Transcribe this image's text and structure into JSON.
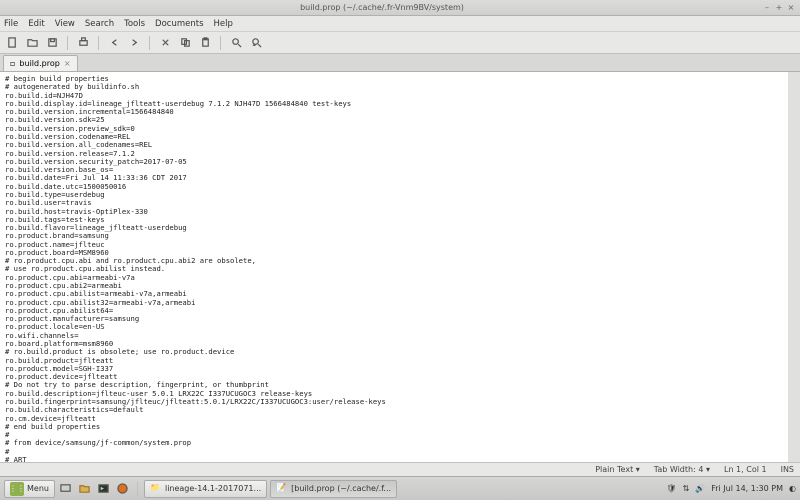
{
  "window": {
    "title": "build.prop (~/.cache/.fr-Vnm9BV/system)",
    "min": "–",
    "max": "+",
    "close": "×"
  },
  "menu": {
    "items": [
      "File",
      "Edit",
      "View",
      "Search",
      "Tools",
      "Documents",
      "Help"
    ]
  },
  "tab": {
    "name": "build.prop",
    "close": "×"
  },
  "content": "# begin build properties\n# autogenerated by buildinfo.sh\nro.build.id=NJH47D\nro.build.display.id=lineage_jflteatt-userdebug 7.1.2 NJH47D 1566484840 test-keys\nro.build.version.incremental=1566484840\nro.build.version.sdk=25\nro.build.version.preview_sdk=0\nro.build.version.codename=REL\nro.build.version.all_codenames=REL\nro.build.version.release=7.1.2\nro.build.version.security_patch=2017-07-05\nro.build.version.base_os=\nro.build.date=Fri Jul 14 11:33:36 CDT 2017\nro.build.date.utc=1500050016\nro.build.type=userdebug\nro.build.user=travis\nro.build.host=travis-OptiPlex-330\nro.build.tags=test-keys\nro.build.flavor=lineage_jflteatt-userdebug\nro.product.brand=samsung\nro.product.name=jflteuc\nro.product.board=MSM8960\n# ro.product.cpu.abi and ro.product.cpu.abi2 are obsolete,\n# use ro.product.cpu.abilist instead.\nro.product.cpu.abi=armeabi-v7a\nro.product.cpu.abi2=armeabi\nro.product.cpu.abilist=armeabi-v7a,armeabi\nro.product.cpu.abilist32=armeabi-v7a,armeabi\nro.product.cpu.abilist64=\nro.product.manufacturer=samsung\nro.product.locale=en-US\nro.wifi.channels=\nro.board.platform=msm8960\n# ro.build.product is obsolete; use ro.product.device\nro.build.product=jflteatt\nro.product.model=SGH-I337\nro.product.device=jflteatt\n# Do not try to parse description, fingerprint, or thumbprint\nro.build.description=jflteuc-user 5.0.1 LRX22C I337UCUGOC3 release-keys\nro.build.fingerprint=samsung/jflteuc/jflteatt:5.0.1/LRX22C/I337UCUGOC3:user/release-keys\nro.build.characteristics=default\nro.cm.device=jflteatt\n# end build properties\n#\n# from device/samsung/jf-common/system.prop\n#\n# ART",
  "status": {
    "syntax": "Plain Text ▾",
    "tabwidth": "Tab Width: 4 ▾",
    "position": "Ln 1, Col 1",
    "mode": "INS"
  },
  "panel": {
    "menu": "Menu",
    "task1": "lineage-14.1-2017071...",
    "task2": "[build.prop (~/.cache/.f...",
    "clock": "Fri Jul 14,  1:30 PM"
  }
}
